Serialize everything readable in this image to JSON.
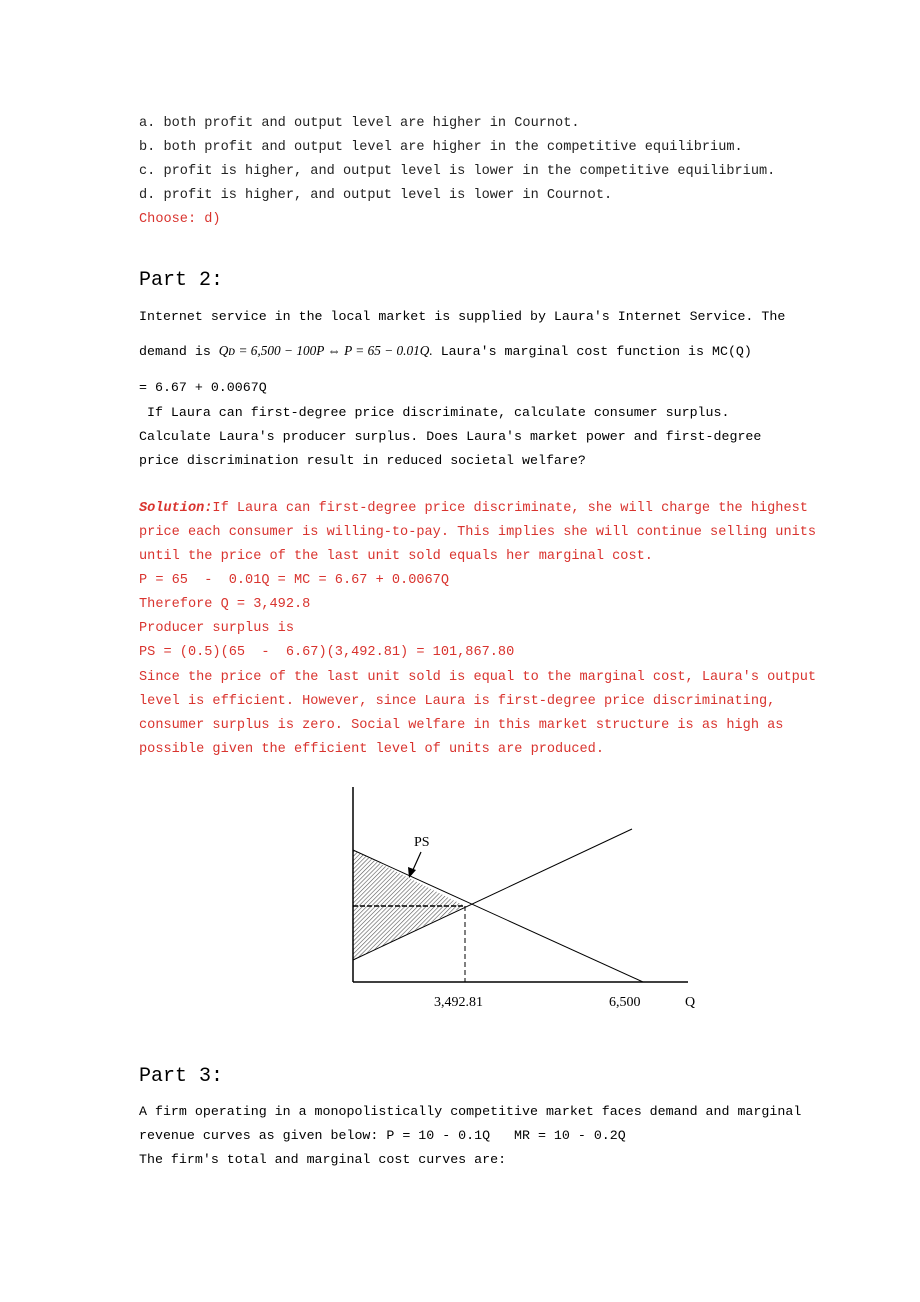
{
  "part1": {
    "options": [
      "a. both profit and output level are higher in Cournot.",
      "b. both profit and output level are higher in the competitive equilibrium.",
      "c. profit is higher, and output level is lower in the competitive equilibrium.",
      "d. profit is higher, and output level is lower in Cournot."
    ],
    "answer": "Choose: d)"
  },
  "part2": {
    "heading": "Part 2:",
    "line1": "Internet service in the local market is supplied by Laura's Internet Service. The",
    "line2_prefix": "demand is ",
    "line2_eq": "Qᴅ = 6,500 − 100P ⇔ P = 65 − 0.01Q.",
    "line2_suffix": " Laura's marginal cost function is MC(Q)",
    "line3": "= 6.67 + 0.0067Q",
    "line4": " If Laura can first-degree price discriminate, calculate consumer surplus.",
    "line5": "Calculate Laura's producer surplus. Does Laura's market power and first-degree",
    "line6": "price discrimination result in reduced societal welfare?",
    "solution_label": "Solution:",
    "solution": [
      "If Laura can first-degree price discriminate, she will charge the highest",
      "price each consumer is willing-to-pay. This implies she will continue selling units",
      "until the price of the last unit sold equals her marginal cost.",
      "P = 65  -  0.01Q = MC = 6.67 + 0.0067Q",
      "Therefore Q = 3,492.8",
      "Producer surplus is",
      "PS = (0.5)(65  -  6.67)(3,492.81) = 101,867.80",
      "Since the price of the last unit sold is equal to the marginal cost, Laura's output",
      "level is efficient. However, since Laura is first-degree price discriminating,",
      "consumer surplus is zero. Social welfare in this market structure is as high as",
      "possible given the efficient level of units are produced."
    ],
    "diagram": {
      "ps_label": "PS",
      "q_star_label": "3,492.81",
      "q_max_label": "6,500",
      "x_axis_label": "Q"
    }
  },
  "part3": {
    "heading": "Part 3:",
    "lines": [
      "A firm operating in a monopolistically competitive market faces demand and marginal",
      "revenue curves as given below: P = 10 - 0.1Q   MR = 10 - 0.2Q",
      "The firm's total and marginal cost curves are:"
    ]
  }
}
